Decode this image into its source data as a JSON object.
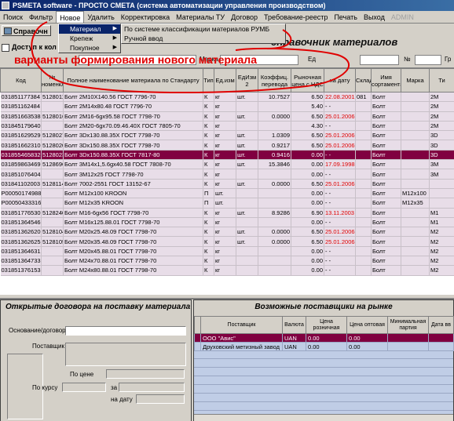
{
  "window": {
    "title": "PSMETA software - ПРОСТО СМЕТА (система автоматизации управления производством)"
  },
  "menubar": [
    "Поиск",
    "Фильтр",
    "Новое",
    "Удалить",
    "Корректировка",
    "Материалы ТУ",
    "Договор",
    "Требование-реестр",
    "Печать",
    "Выход",
    "ADMIN"
  ],
  "menu_active": "Новое",
  "dropdown": {
    "items": [
      "Материал",
      "Крепеж",
      "Покупное"
    ],
    "submenu": [
      "По системе классификации материалов РУМБ",
      "Ручной ввод"
    ]
  },
  "toolbar": {
    "reference_button": "Справочн",
    "page_title": "справочник материалов"
  },
  "filter": {
    "checkbox_label": "Доступ к кол",
    "label_marka": "Марка",
    "label_num": "№",
    "label_gr": "Гр",
    "label_ed": "Ед"
  },
  "annotation": "варианты формирования нового материала",
  "grid": {
    "headers": [
      "Код",
      "№ номенклатурный",
      "Полное наименование материала по Стандарту",
      "Тип",
      "Ед.изм",
      "ЕдИзм 2",
      "Коэффиц. перевода",
      "Рыночная цена с НДС",
      "на дату",
      "Склад",
      "Имя сортамента",
      "Марка",
      "Ти"
    ],
    "rows": [
      [
        "031851177384",
        "5128011",
        "Болт 2М10Х140.56 ГОСТ 7796-70",
        "К",
        "кг",
        "шт.",
        "10.7527",
        "6.50",
        "22.08.2001",
        "081",
        "Болт",
        "",
        "2M"
      ],
      [
        "031851162484",
        "",
        "Болт 2М14х80.48 ГОСТ 7796-70",
        "К",
        "кг",
        "",
        "",
        "5.40",
        "- -",
        "",
        "Болт",
        "",
        "2M"
      ],
      [
        "031851663538",
        "5128016",
        "Болт 2М16-6gх95.58 ГОСТ 7798-70",
        "К",
        "кг",
        "шт.",
        "0.0000",
        "6.50",
        "25.01.2006",
        "",
        "Болт",
        "",
        "2M"
      ],
      [
        "031845179640",
        "",
        "Болт 2М20-6gх70.09.46.40Х ГОСТ 7805-70",
        "К",
        "кг",
        "",
        "",
        "4.30",
        "- -",
        "",
        "Болт",
        "",
        "2M"
      ],
      [
        "031851629529",
        "5128027",
        "Болт 3Dх130.88.35Х ГОСТ 7798-70",
        "К",
        "кг",
        "шт.",
        "1.0309",
        "6.50",
        "25.01.2006",
        "",
        "Болт",
        "",
        "3D"
      ],
      [
        "031851662310",
        "5128020",
        "Болт 3Dх150.88.35Х ГОСТ 7798-70",
        "К",
        "кг",
        "шт.",
        "0.9217",
        "6.50",
        "25.01.2006",
        "",
        "Болт",
        "",
        "3D"
      ],
      [
        "031855465832",
        "5128023",
        "Болт 3Dх150.88.35Х ГОСТ 7817-80",
        "К",
        "кг",
        "шт.",
        "0.9416",
        "0.00",
        "- -",
        "",
        "Болт",
        "",
        "3D"
      ],
      [
        "031859863469",
        "5128696",
        "Болт 3М14х1,5.6gх40.58 ГОСТ 7808-70",
        "К",
        "кг",
        "шт.",
        "15.3846",
        "0.00",
        "17.09.1998",
        "",
        "Болт",
        "",
        "3M"
      ],
      [
        "031851076404",
        "",
        "Болт 3М12х25 ГОСТ 7798-70",
        "К",
        "кг",
        "",
        "",
        "0.00",
        "- -",
        "",
        "Болт",
        "",
        "3M"
      ],
      [
        "031841102003",
        "5128114",
        "Болт 7002-2551 ГОСТ 13152-67",
        "К",
        "кг",
        "шт.",
        "0.0000",
        "6.50",
        "25.01.2006",
        "",
        "Болт",
        "",
        ""
      ],
      [
        "Р00050174988",
        "",
        "Болт М12х100 KROON",
        "П",
        "шт.",
        "",
        "",
        "0.00",
        "- -",
        "",
        "Болт",
        "M12х100",
        ""
      ],
      [
        "Р00050433316",
        "",
        "Болт М12х35 KROON",
        "П",
        "шт.",
        "",
        "",
        "0.00",
        "- -",
        "",
        "Болт",
        "M12х35",
        ""
      ],
      [
        "031851776530",
        "5128240",
        "Болт М16-6gх56 ГОСТ 7798-70",
        "К",
        "кг",
        "шт.",
        "8.9286",
        "6.90",
        "13.11.2003",
        "",
        "Болт",
        "",
        "M1"
      ],
      [
        "031851364546",
        "",
        "Болт М16х125.88.01 ГОСТ 7798-70",
        "К",
        "кг",
        "",
        "",
        "0.00",
        "- -",
        "",
        "Болт",
        "",
        "M1"
      ],
      [
        "031851362620",
        "5128104",
        "Болт М20х25.48.09 ГОСТ 7798-70",
        "К",
        "кг",
        "шт.",
        "0.0000",
        "6.50",
        "25.01.2006",
        "",
        "Болт",
        "",
        "M2"
      ],
      [
        "031851362625",
        "5128105",
        "Болт М20х35.48.09 ГОСТ 7798-70",
        "К",
        "кг",
        "шт.",
        "0.0000",
        "6.50",
        "25.01.2006",
        "",
        "Болт",
        "",
        "M2"
      ],
      [
        "031851364631",
        "",
        "Болт М20х45.88.01 ГОСТ 7798-70",
        "К",
        "кг",
        "",
        "",
        "0.00",
        "- -",
        "",
        "Болт",
        "",
        "M2"
      ],
      [
        "031851364733",
        "",
        "Болт М24х70.88.01 ГОСТ 7798-70",
        "К",
        "кг",
        "",
        "",
        "0.00",
        "- -",
        "",
        "Болт",
        "",
        "M2"
      ],
      [
        "031851376153",
        "",
        "Болт М24х80.88.01 ГОСТ 7798-70",
        "К",
        "кг",
        "",
        "",
        "0.00",
        "- -",
        "",
        "Болт",
        "",
        "M2"
      ]
    ],
    "selected_row": 6
  },
  "contracts": {
    "title": "Открытые договора на поставку материала",
    "label_basis": "Основание/договор",
    "label_supplier": "Поставщик",
    "label_price": "По цене",
    "label_rate": "По курсу",
    "label_for": "за",
    "label_date": "на дату"
  },
  "suppliers": {
    "title": "Возможные поставщики на рынке",
    "headers": [
      "Поставщик",
      "Валюта",
      "Цена розничная",
      "Цена оптовая",
      "Минимальная партия",
      "Дата вв"
    ],
    "rows": [
      [
        "ООО \"Авис\"",
        "UAN",
        "0.00",
        "0.00",
        "",
        ""
      ],
      [
        "Друховский метизный завод",
        "UAN",
        "0.00",
        "0.00",
        "",
        ""
      ]
    ]
  },
  "colors": {
    "selected": "#800040",
    "annotation": "#e00000",
    "row_bg": "#e8dde8"
  }
}
